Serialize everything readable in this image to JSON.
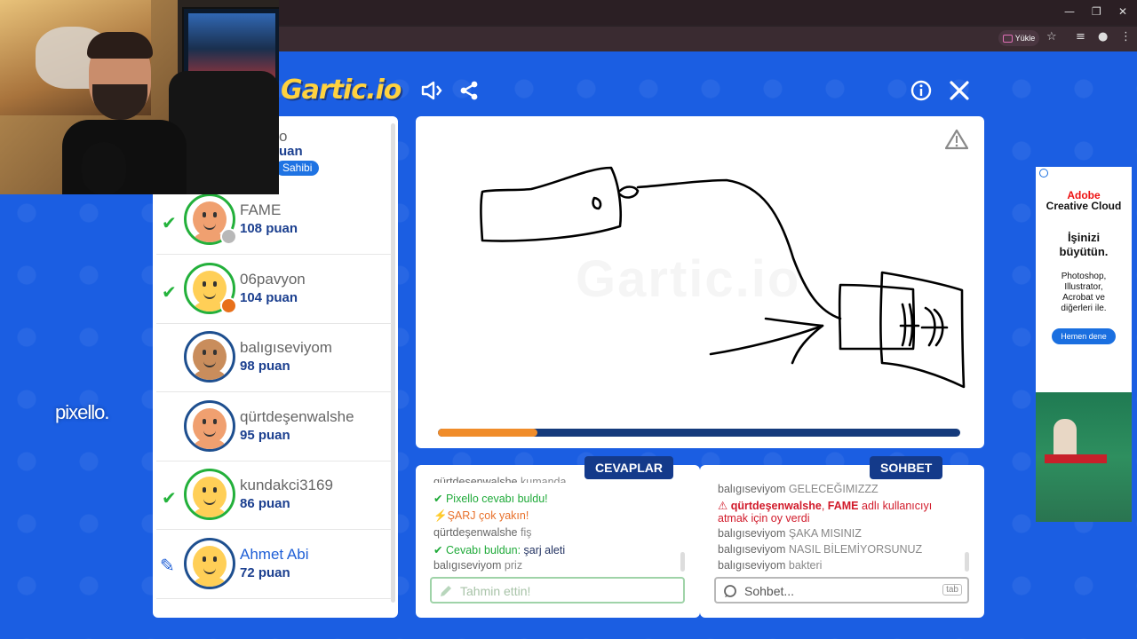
{
  "browser": {
    "upload_label": "Yükle"
  },
  "app": {
    "logo": "Gartic.io",
    "side_watermark": "pixello."
  },
  "owner": {
    "name_partial": "o",
    "score_partial": "uan",
    "badge": "Sahibi"
  },
  "players": [
    {
      "name": "FAME",
      "score": "108 puan",
      "guessed": true,
      "drawing": false,
      "status_color": "#b8b8b8",
      "avatar_border": "#23b03b",
      "face_color": "#f0a070"
    },
    {
      "name": "06pavyon",
      "score": "104 puan",
      "guessed": true,
      "drawing": false,
      "status_color": "#e8701a",
      "avatar_border": "#23b03b",
      "face_color": "#ffcf57"
    },
    {
      "name": "balıgıseviyom",
      "score": "98 puan",
      "guessed": false,
      "drawing": false,
      "status_color": "",
      "avatar_border": "#1e4f8f",
      "face_color": "#c98d5c"
    },
    {
      "name": "qürtdeşenwalshe",
      "score": "95 puan",
      "guessed": false,
      "drawing": false,
      "status_color": "",
      "avatar_border": "#1e4f8f",
      "face_color": "#f0a070"
    },
    {
      "name": "kundakci3169",
      "score": "86 puan",
      "guessed": true,
      "drawing": false,
      "status_color": "",
      "avatar_border": "#23b03b",
      "face_color": "#ffcf57"
    },
    {
      "name": "Ahmet Abi",
      "score": "72 puan",
      "guessed": false,
      "drawing": true,
      "status_color": "",
      "avatar_border": "#1e4f8f",
      "face_color": "#ffcf57"
    }
  ],
  "round": {
    "progress": 0.19
  },
  "answers": {
    "tag": "CEVAPLAR",
    "messages": [
      {
        "user": "qürtdeşenwalshe",
        "text": "kumanda"
      },
      {
        "user": "Pixello",
        "text": "cevabı buldu!"
      },
      {
        "user": "ŞARJ",
        "text": "çok yakın!"
      },
      {
        "user": "qürtdeşenwalshe",
        "text": "fiş"
      },
      {
        "user": "Cevabı buldun:",
        "text": "şarj aleti"
      },
      {
        "user": "balıgıseviyom",
        "text": "priz"
      }
    ],
    "input_placeholder": "Tahmin ettin!"
  },
  "chat": {
    "tag": "SOHBET",
    "messages": [
      {
        "user": "balıgıseviyom",
        "text": "GELECEĞIMIZZZ"
      },
      {
        "user": "qürtdeşenwalshe",
        "text": ", ",
        "target": "FAME",
        "suffix": "adlı kullanıcıyı",
        "line2": "atmak için oy verdi"
      },
      {
        "user": "balıgıseviyom",
        "text": "ŞAKA MISINIZ"
      },
      {
        "user": "balıgıseviyom",
        "text": "NASIL BİLEMİYORSUNUZ"
      },
      {
        "user": "balıgıseviyom",
        "text": "bakteri"
      }
    ],
    "input_placeholder": "Sohbet...",
    "tab_key": "tab"
  },
  "ad": {
    "brand_line1": "Adobe",
    "brand_line2": "Creative Cloud",
    "headline_1": "İşinizi",
    "headline_2": "büyütün.",
    "body_1": "Photoshop,",
    "body_2": "Illustrator,",
    "body_3": "Acrobat ve",
    "body_4": "diğerleri ile.",
    "cta": "Hemen dene"
  },
  "colors": {
    "background": "#1b5ee2",
    "accent_green": "#23b03b",
    "navy": "#143a8a",
    "progress_fill": "#f08c2a"
  }
}
